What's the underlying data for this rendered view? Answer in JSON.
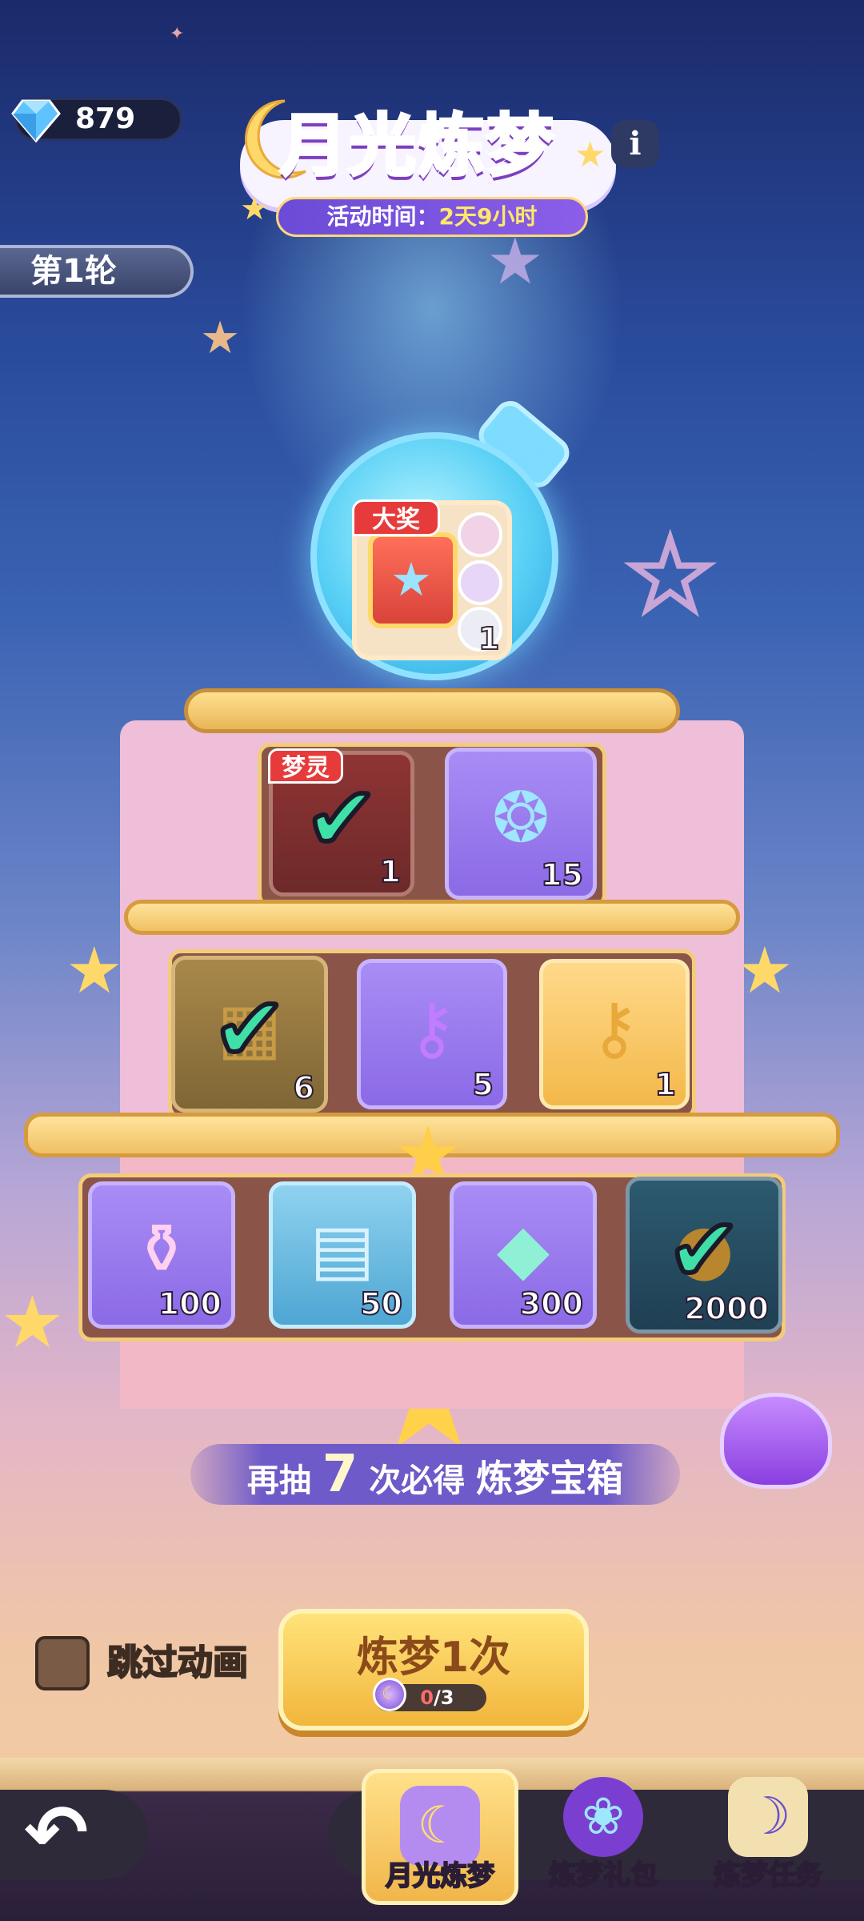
{
  "currency": {
    "gems": "879"
  },
  "header": {
    "title": "月光炼梦",
    "time_label": "活动时间：",
    "time_value": "2天9小时",
    "info_label": "i"
  },
  "round": {
    "label": "第1轮"
  },
  "grand_prize": {
    "badge": "大奖",
    "quantity": "1"
  },
  "tiers": {
    "top": [
      {
        "badge": "梦灵",
        "quantity": "1",
        "claimed": true
      },
      {
        "quantity": "15",
        "claimed": false
      }
    ],
    "middle": [
      {
        "quantity": "6",
        "claimed": true
      },
      {
        "quantity": "5",
        "claimed": false
      },
      {
        "quantity": "1",
        "claimed": false
      }
    ],
    "bottom": [
      {
        "quantity": "100",
        "claimed": false
      },
      {
        "quantity": "50",
        "claimed": false
      },
      {
        "quantity": "300",
        "claimed": false
      },
      {
        "quantity": "2000",
        "claimed": true
      }
    ]
  },
  "pity": {
    "prefix": "再抽",
    "count": "7",
    "middle": "次必得",
    "reward": "炼梦宝箱"
  },
  "skip": {
    "label": "跳过动画"
  },
  "draw": {
    "label": "炼梦1次",
    "cost_current": "0",
    "cost_total": "/3"
  },
  "tabs": [
    {
      "label": "月光炼梦",
      "active": true
    },
    {
      "label": "炼梦礼包",
      "active": false
    },
    {
      "label": "炼梦任务",
      "active": false
    }
  ],
  "colors": {
    "accent_purple": "#b86ff0",
    "gold": "#f2b63c",
    "check_green": "#3fe0a8",
    "badge_red": "#e73b3b"
  },
  "icons": {
    "gem": "gem-icon",
    "info": "info-icon",
    "check": "check-icon",
    "back": "back-arrow-icon"
  }
}
